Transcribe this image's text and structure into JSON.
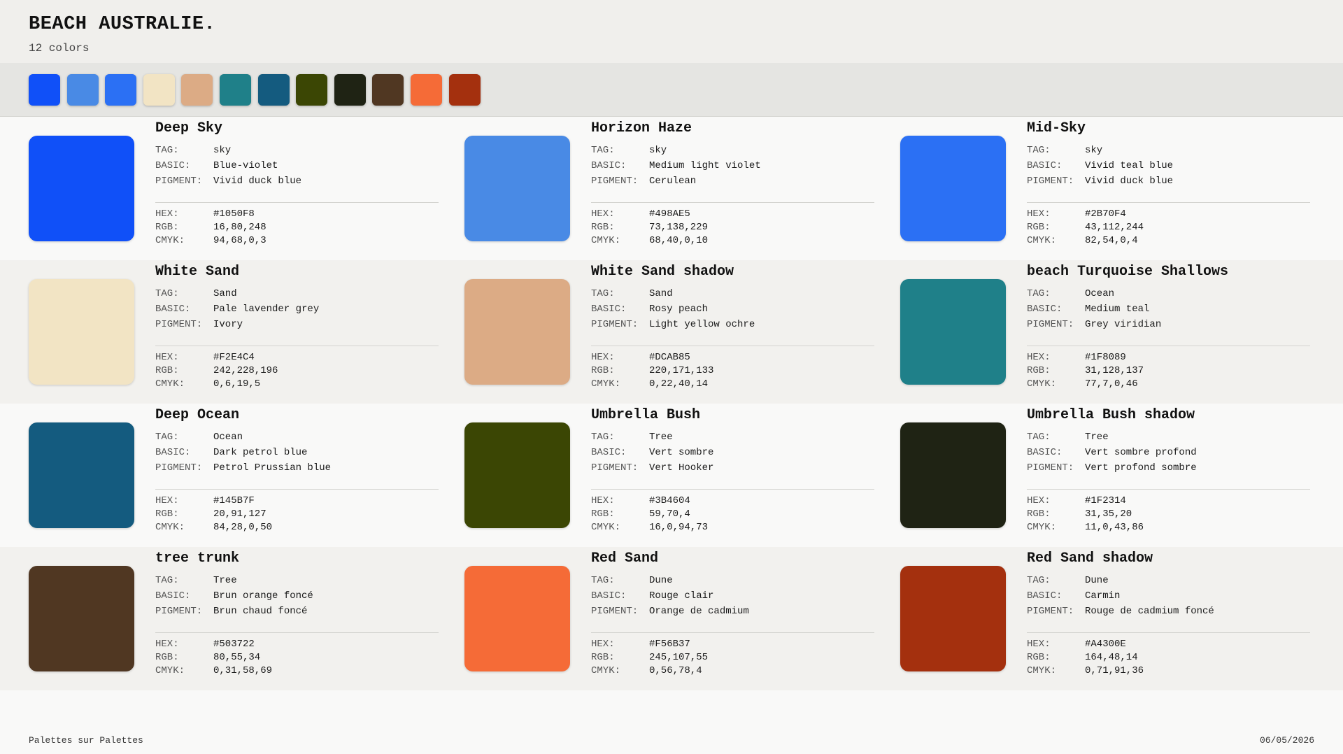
{
  "header": {
    "title": "BEACH AUSTRALIE.",
    "subtitle": "12 colors"
  },
  "labels": {
    "tag": "TAG:",
    "basic": "BASIC:",
    "pigment": "PIGMENT:",
    "hex": "HEX:",
    "rgb": "RGB:",
    "cmyk": "CMYK:"
  },
  "colors": [
    {
      "name": "Deep Sky",
      "tag": "sky",
      "basic": "Blue-violet",
      "pigment": "Vivid duck blue",
      "hex": "#1050F8",
      "rgb": "16,80,248",
      "cmyk": "94,68,0,3"
    },
    {
      "name": "Horizon Haze",
      "tag": "sky",
      "basic": "Medium light violet",
      "pigment": "Cerulean",
      "hex": "#498AE5",
      "rgb": "73,138,229",
      "cmyk": "68,40,0,10"
    },
    {
      "name": "Mid-Sky",
      "tag": "sky",
      "basic": "Vivid teal blue",
      "pigment": "Vivid duck blue",
      "hex": "#2B70F4",
      "rgb": "43,112,244",
      "cmyk": "82,54,0,4"
    },
    {
      "name": "White Sand",
      "tag": "Sand",
      "basic": "Pale lavender grey",
      "pigment": "Ivory",
      "hex": "#F2E4C4",
      "rgb": "242,228,196",
      "cmyk": "0,6,19,5"
    },
    {
      "name": "White Sand shadow",
      "tag": "Sand",
      "basic": "Rosy peach",
      "pigment": "Light yellow ochre",
      "hex": "#DCAB85",
      "rgb": "220,171,133",
      "cmyk": "0,22,40,14"
    },
    {
      "name": "beach Turquoise Shallows",
      "tag": "Ocean",
      "basic": "Medium teal",
      "pigment": "Grey viridian",
      "hex": "#1F8089",
      "rgb": "31,128,137",
      "cmyk": "77,7,0,46"
    },
    {
      "name": "Deep Ocean",
      "tag": "Ocean",
      "basic": "Dark petrol blue",
      "pigment": "Petrol Prussian blue",
      "hex": "#145B7F",
      "rgb": "20,91,127",
      "cmyk": "84,28,0,50"
    },
    {
      "name": "Umbrella Bush",
      "tag": "Tree",
      "basic": "Vert sombre",
      "pigment": "Vert Hooker",
      "hex": "#3B4604",
      "rgb": "59,70,4",
      "cmyk": "16,0,94,73"
    },
    {
      "name": "Umbrella Bush shadow",
      "tag": "Tree",
      "basic": "Vert sombre profond",
      "pigment": "Vert profond sombre",
      "hex": "#1F2314",
      "rgb": "31,35,20",
      "cmyk": "11,0,43,86"
    },
    {
      "name": "tree trunk",
      "tag": "Tree",
      "basic": "Brun orange foncé",
      "pigment": "Brun chaud foncé",
      "hex": "#503722",
      "rgb": "80,55,34",
      "cmyk": "0,31,58,69"
    },
    {
      "name": "Red Sand",
      "tag": "Dune",
      "basic": "Rouge clair",
      "pigment": "Orange de cadmium",
      "hex": "#F56B37",
      "rgb": "245,107,55",
      "cmyk": "0,56,78,4"
    },
    {
      "name": "Red Sand shadow",
      "tag": "Dune",
      "basic": "Carmin",
      "pigment": "Rouge de cadmium foncé",
      "hex": "#A4300E",
      "rgb": "164,48,14",
      "cmyk": "0,71,91,36"
    }
  ],
  "footer": {
    "left": "Palettes sur Palettes",
    "right": "06/05/2026"
  }
}
